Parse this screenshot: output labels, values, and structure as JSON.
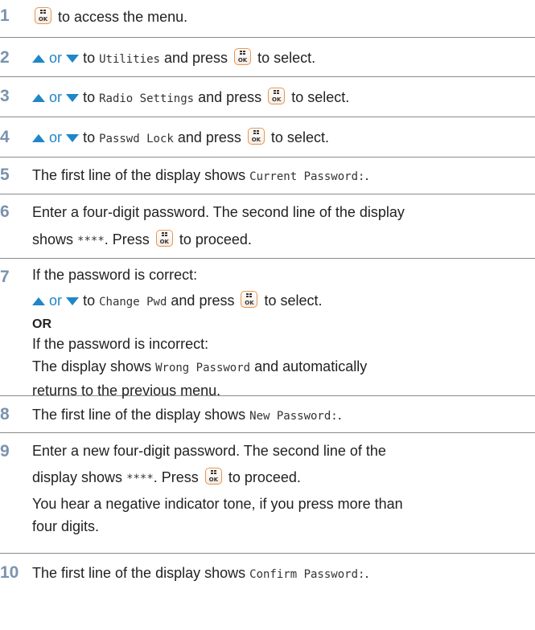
{
  "steps": [
    {
      "n": "1",
      "text": "to access the menu."
    },
    {
      "n": "2",
      "or": "or",
      "to": "to",
      "mono": "Utilities",
      "press": "and press",
      "select": "to select."
    },
    {
      "n": "3",
      "or": "or",
      "to": "to",
      "mono": "Radio Settings",
      "press": "and press",
      "select": "to select."
    },
    {
      "n": "4",
      "or": "or",
      "to": "to",
      "mono": "Passwd Lock",
      "press": "and press",
      "select": "to select."
    },
    {
      "n": "5",
      "pre": "The first line of the display shows",
      "mono": "Current Password:",
      "post": "."
    },
    {
      "n": "6",
      "line1": "Enter a four-digit password. The second line of the display",
      "pre": "shows",
      "mono": "****",
      "post": ". Press",
      "proceed": "to proceed."
    },
    {
      "n": "7",
      "correct": "If the password is correct:",
      "or": "or",
      "to": "to",
      "mono": "Change Pwd",
      "press": "and press",
      "select": "to select.",
      "or_upper": "OR",
      "incorrect": "If the password is incorrect:",
      "pre": "The display shows",
      "mono2": "Wrong Password",
      "post": "and automatically",
      "line_end": "returns to the previous menu."
    },
    {
      "n": "8",
      "pre": "The first line of the display shows",
      "mono": "New Password:",
      "post": "."
    },
    {
      "n": "9",
      "line1": "Enter a new four-digit password. The second line of the",
      "pre": "display shows",
      "mono": "****",
      "post": ". Press",
      "proceed": "to proceed.",
      "line3": "You hear a negative indicator tone, if you press more than",
      "line4": "four digits."
    },
    {
      "n": "10",
      "pre": "The first line of the display shows",
      "mono": "Confirm Password:",
      "post": "."
    }
  ],
  "icons": {
    "ok": "ok-menu-key-icon",
    "up": "up-arrow-icon",
    "down": "down-arrow-icon",
    "ok_label": "OK"
  },
  "colors": {
    "number": "#7a93ad",
    "nav": "#1f86c8",
    "arrow": "#1f86c8",
    "icon_border": "#e8964e",
    "rule": "#8a8a8a"
  }
}
